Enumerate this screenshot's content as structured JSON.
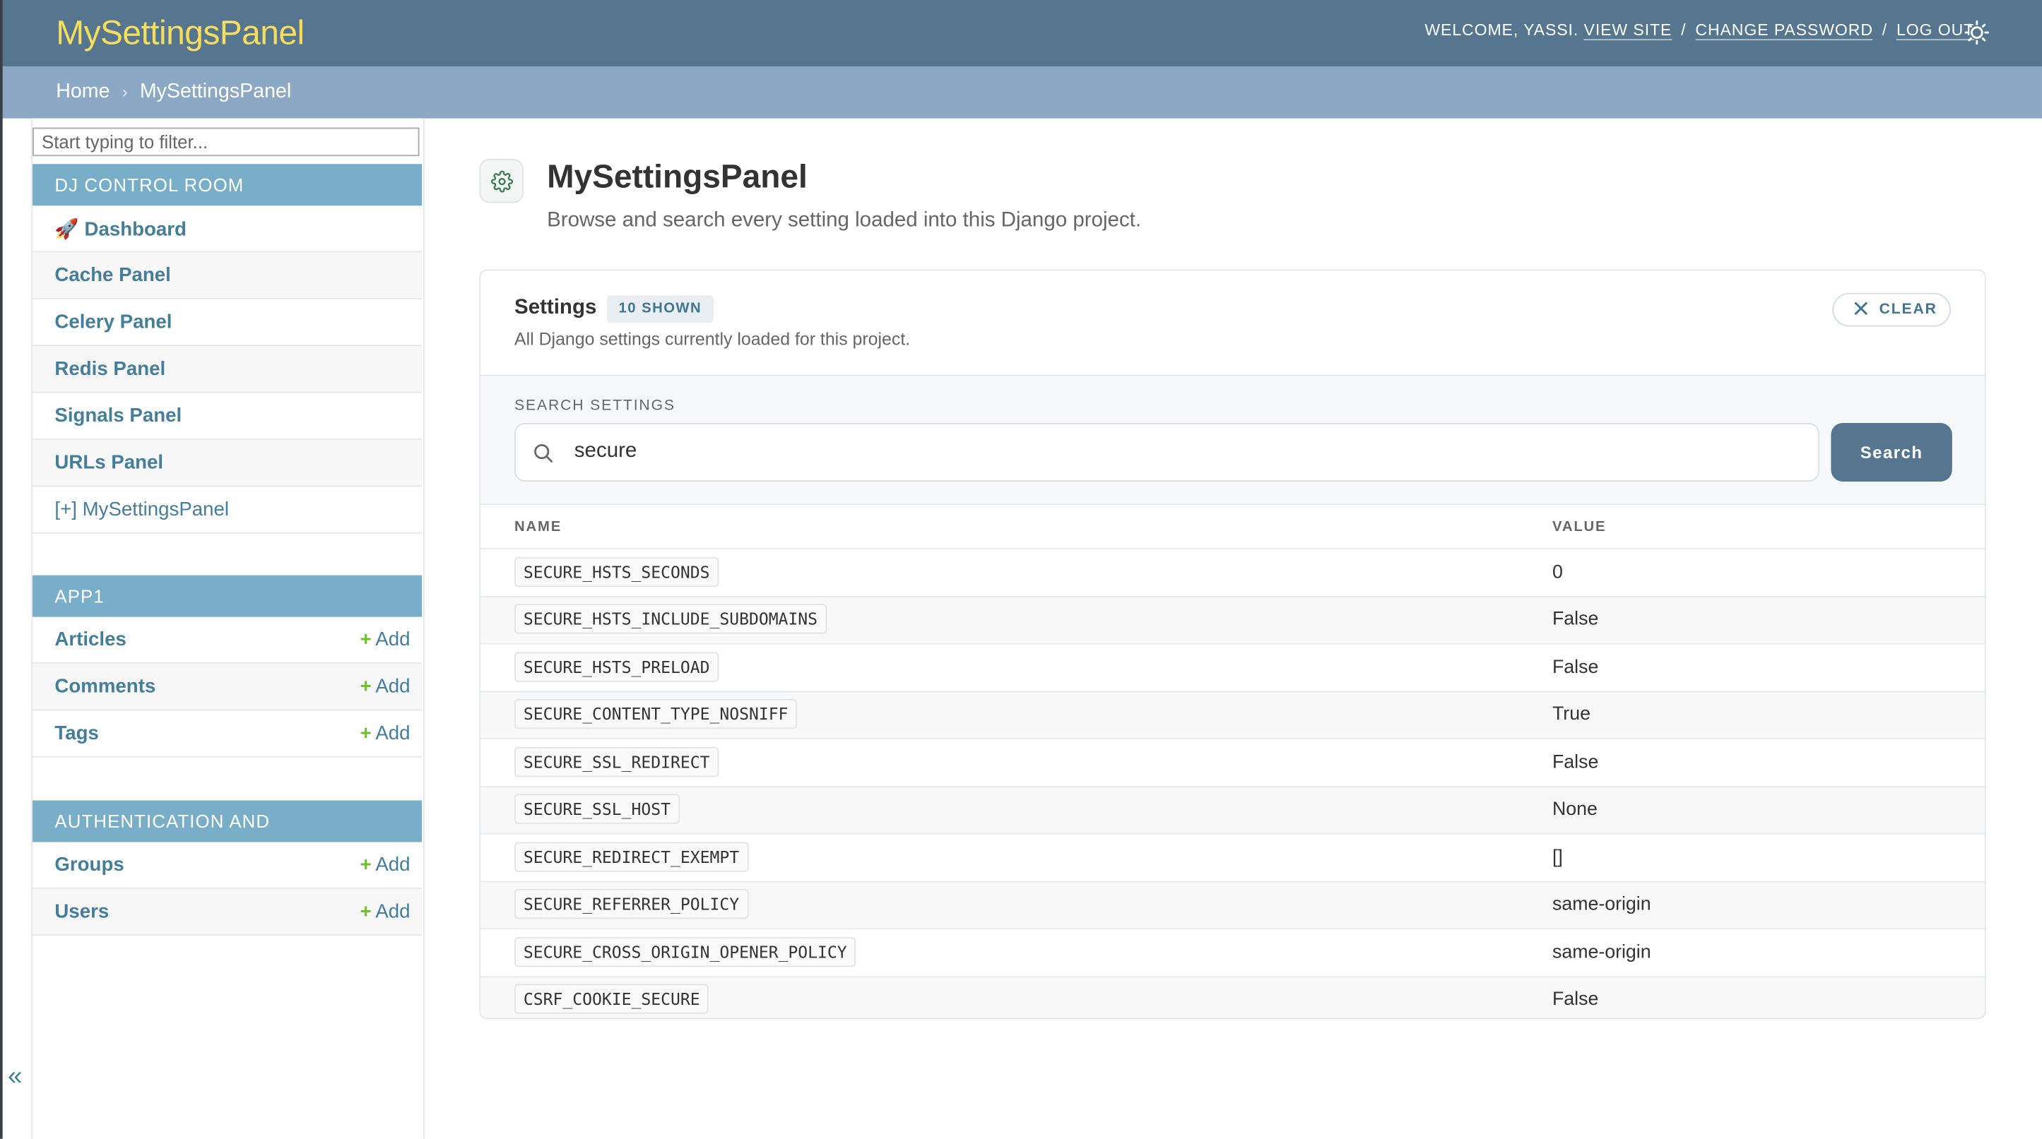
{
  "header": {
    "brand": "MySettingsPanel",
    "welcome": "WELCOME, YASSI.",
    "view_site": "VIEW SITE",
    "change_password": "CHANGE PASSWORD",
    "log_out": "LOG OUT",
    "separator": "/"
  },
  "breadcrumbs": {
    "home": "Home",
    "chevron": "›",
    "current": "MySettingsPanel"
  },
  "sidebar": {
    "filter_placeholder": "Start typing to filter...",
    "collapse_glyph": "«",
    "modules": [
      {
        "title": "DJ CONTROL ROOM",
        "items": [
          {
            "label": "🚀 Dashboard"
          },
          {
            "label": "Cache Panel"
          },
          {
            "label": "Celery Panel"
          },
          {
            "label": "Redis Panel"
          },
          {
            "label": "Signals Panel"
          },
          {
            "label": "URLs Panel"
          },
          {
            "label": "[+] MySettingsPanel"
          }
        ]
      },
      {
        "title": "APP1",
        "items": [
          {
            "label": "Articles",
            "add": "Add"
          },
          {
            "label": "Comments",
            "add": "Add"
          },
          {
            "label": "Tags",
            "add": "Add"
          }
        ]
      },
      {
        "title": "AUTHENTICATION AND AUTHORIZATION",
        "items": [
          {
            "label": "Groups",
            "add": "Add"
          },
          {
            "label": "Users",
            "add": "Add"
          }
        ]
      }
    ]
  },
  "main": {
    "title": "MySettingsPanel",
    "subtitle": "Browse and search every setting loaded into this Django project.",
    "card": {
      "title": "Settings",
      "badge": "10 SHOWN",
      "description": "All Django settings currently loaded for this project.",
      "clear_label": "CLEAR"
    },
    "search": {
      "label": "SEARCH SETTINGS",
      "value": "secure",
      "button": "Search"
    },
    "table": {
      "columns": [
        "NAME",
        "VALUE"
      ],
      "rows": [
        {
          "name": "SECURE_HSTS_SECONDS",
          "value": "0"
        },
        {
          "name": "SECURE_HSTS_INCLUDE_SUBDOMAINS",
          "value": "False"
        },
        {
          "name": "SECURE_HSTS_PRELOAD",
          "value": "False"
        },
        {
          "name": "SECURE_CONTENT_TYPE_NOSNIFF",
          "value": "True"
        },
        {
          "name": "SECURE_SSL_REDIRECT",
          "value": "False"
        },
        {
          "name": "SECURE_SSL_HOST",
          "value": "None"
        },
        {
          "name": "SECURE_REDIRECT_EXEMPT",
          "value": "[]"
        },
        {
          "name": "SECURE_REFERRER_POLICY",
          "value": "same-origin"
        },
        {
          "name": "SECURE_CROSS_ORIGIN_OPENER_POLICY",
          "value": "same-origin"
        },
        {
          "name": "CSRF_COOKIE_SECURE",
          "value": "False"
        }
      ]
    }
  },
  "icons": {
    "theme": "sun-icon",
    "title": "gear-icon",
    "clear": "close-icon",
    "search": "search-icon",
    "add": "plus-icon"
  },
  "colors": {
    "header": "#56758f",
    "brand": "#f5dd5d",
    "breadcrumbs": "#8ba9c4",
    "module_header": "#79aec8",
    "link": "#447e9b",
    "add_plus": "#70bf2b"
  }
}
